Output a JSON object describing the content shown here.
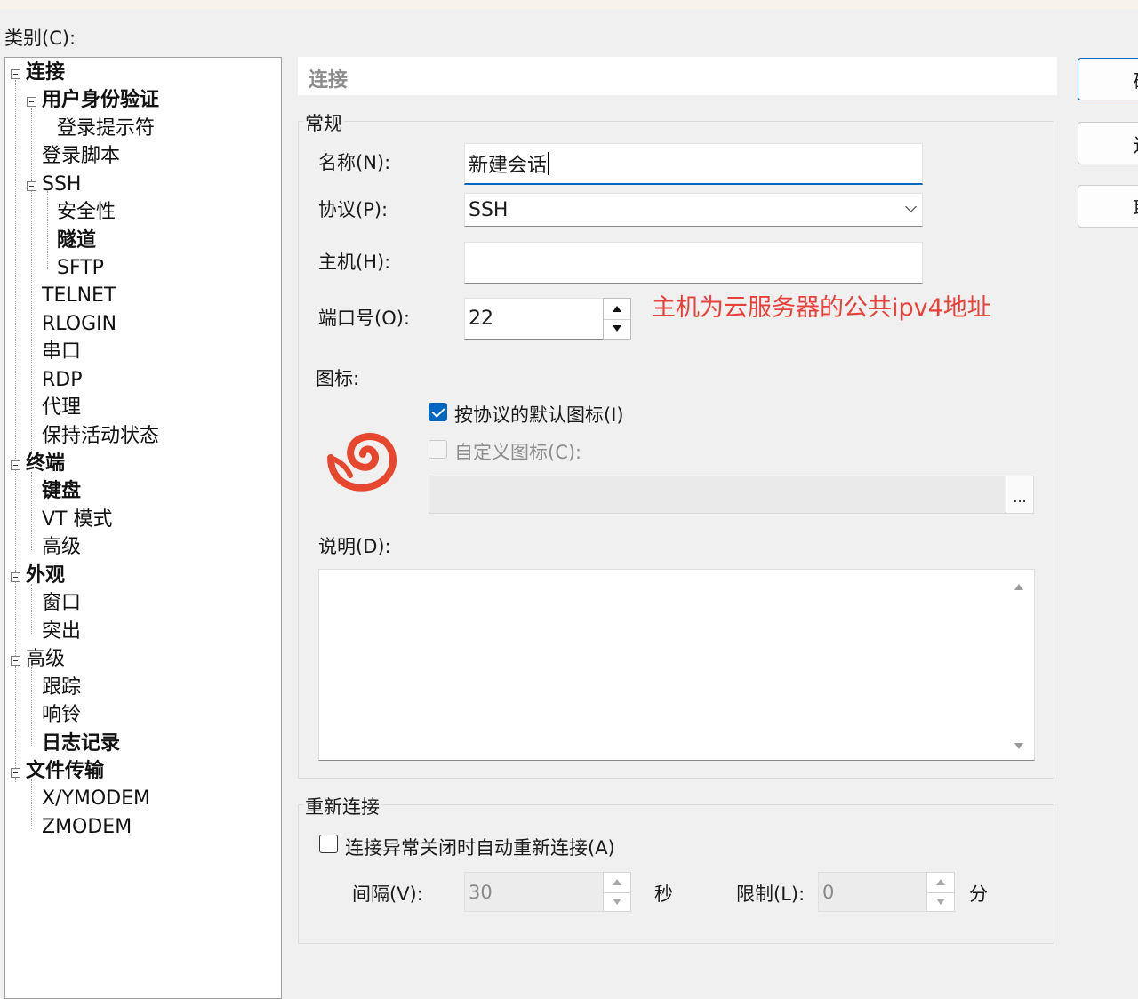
{
  "category_label": "类别(C):",
  "tree": {
    "items": [
      {
        "label": "连接"
      },
      {
        "label": "用户身份验证"
      },
      {
        "label": "登录提示符"
      },
      {
        "label": "登录脚本"
      },
      {
        "label": "SSH"
      },
      {
        "label": "安全性"
      },
      {
        "label": "隧道"
      },
      {
        "label": "SFTP"
      },
      {
        "label": "TELNET"
      },
      {
        "label": "RLOGIN"
      },
      {
        "label": "串口"
      },
      {
        "label": "RDP"
      },
      {
        "label": "代理"
      },
      {
        "label": "保持活动状态"
      },
      {
        "label": "终端"
      },
      {
        "label": "键盘"
      },
      {
        "label": "VT 模式"
      },
      {
        "label": "高级"
      },
      {
        "label": "外观"
      },
      {
        "label": "窗口"
      },
      {
        "label": "突出"
      },
      {
        "label": "高级"
      },
      {
        "label": "跟踪"
      },
      {
        "label": "响铃"
      },
      {
        "label": "日志记录"
      },
      {
        "label": "文件传输"
      },
      {
        "label": "X/YMODEM"
      },
      {
        "label": "ZMODEM"
      }
    ]
  },
  "panel": {
    "header": "连接",
    "general": {
      "title": "常规",
      "name_label": "名称(N):",
      "name_value": "新建会话",
      "protocol_label": "协议(P):",
      "protocol_value": "SSH",
      "host_label": "主机(H):",
      "host_value": "",
      "port_label": "端口号(O):",
      "port_value": "22",
      "annotation": "主机为云服务器的公共ipv4地址",
      "icon_label": "图标:",
      "default_icon_label": "按协议的默认图标(I)",
      "default_icon_checked": true,
      "custom_icon_label": "自定义图标(C):",
      "custom_icon_checked": false,
      "browse_label": "...",
      "description_label": "说明(D):",
      "description_value": ""
    },
    "reconnect": {
      "title": "重新连接",
      "auto_label": "连接异常关闭时自动重新连接(A)",
      "auto_checked": false,
      "interval_label": "间隔(V):",
      "interval_value": "30",
      "interval_unit": "秒",
      "limit_label": "限制(L):",
      "limit_value": "0",
      "limit_unit": "分"
    }
  },
  "buttons": {
    "btn1": "确",
    "btn2": "连",
    "btn3": "取"
  },
  "colors": {
    "accent": "#0067c0",
    "annotation": "#e8413a",
    "logo": "#e8472f"
  }
}
